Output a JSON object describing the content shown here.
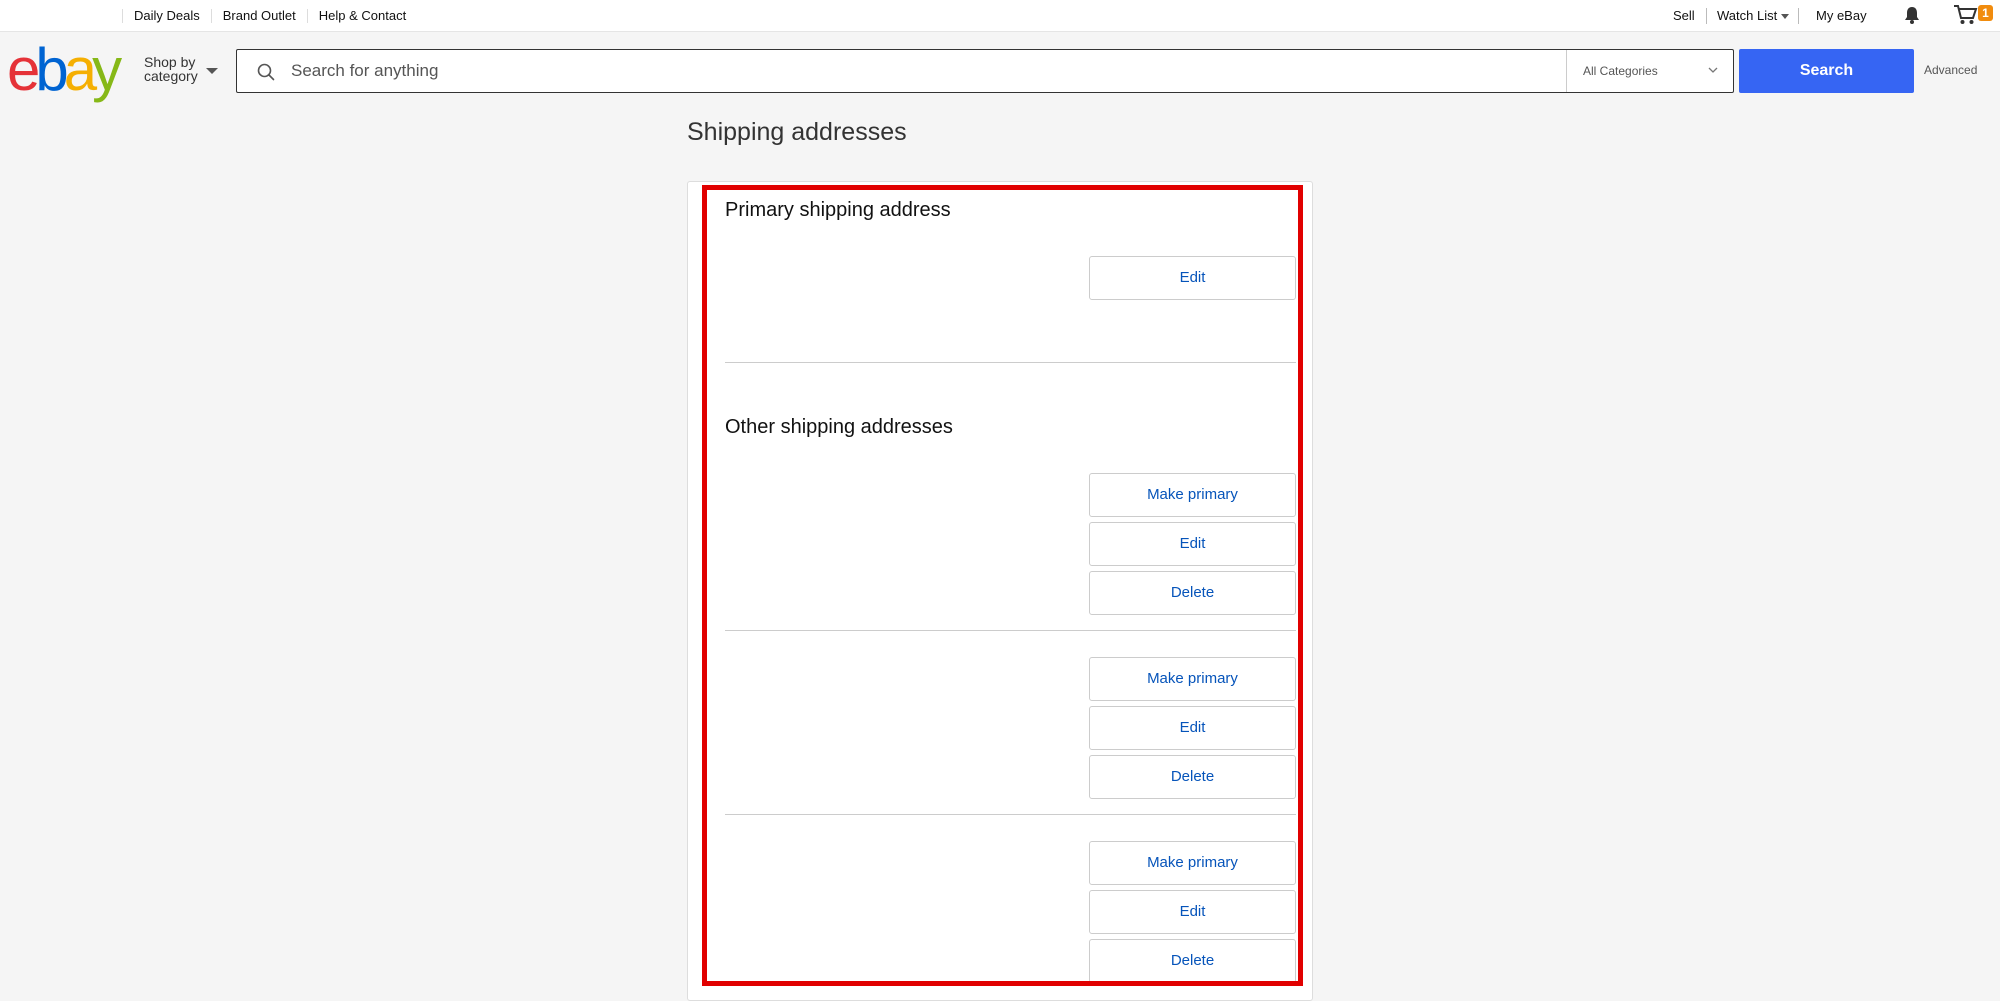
{
  "topbar": {
    "left_links": [
      "Daily Deals",
      "Brand Outlet",
      "Help & Contact"
    ],
    "sell": "Sell",
    "watch_list": "Watch List",
    "my_ebay": "My eBay",
    "cart_count": "1"
  },
  "header": {
    "logo_letters": [
      "e",
      "b",
      "a",
      "y"
    ],
    "shop_by_line1": "Shop by",
    "shop_by_line2": "category",
    "search_placeholder": "Search for anything",
    "category_selected": "All Categories",
    "search_button": "Search",
    "advanced_link": "Advanced"
  },
  "colors": {
    "brand_red": "#e53238",
    "brand_blue": "#0064d2",
    "brand_yellow": "#f5af02",
    "brand_green": "#86b817",
    "search_button": "#3665f3",
    "link_blue": "#0654ba",
    "highlight": "#e10000"
  },
  "page": {
    "title": "Shipping addresses",
    "primary_section_title": "Primary shipping address",
    "primary_edit": "Edit",
    "other_section_title": "Other shipping addresses",
    "other_addresses": [
      {
        "make_primary": "Make primary",
        "edit": "Edit",
        "delete": "Delete"
      },
      {
        "make_primary": "Make primary",
        "edit": "Edit",
        "delete": "Delete"
      },
      {
        "make_primary": "Make primary",
        "edit": "Edit",
        "delete": "Delete"
      }
    ]
  }
}
